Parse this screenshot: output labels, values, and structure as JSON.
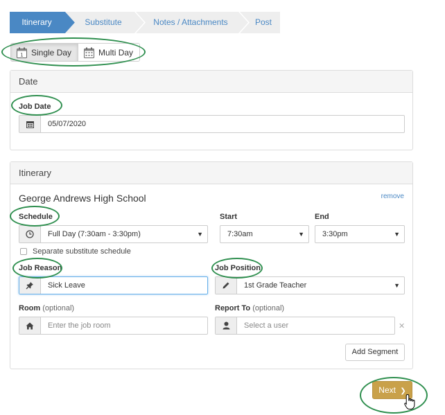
{
  "wizard": {
    "steps": [
      "Itinerary",
      "Substitute",
      "Notes / Attachments",
      "Post"
    ],
    "active_index": 0
  },
  "day_toggle": {
    "single_label": "Single Day",
    "multi_label": "Multi Day",
    "selected": "single",
    "single_icon_text": "1"
  },
  "date_panel": {
    "title": "Date",
    "job_date_label": "Job Date",
    "job_date_value": "05/07/2020"
  },
  "itinerary_panel": {
    "title": "Itinerary",
    "school": "George Andrews High School",
    "remove_label": "remove",
    "schedule_label": "Schedule",
    "schedule_value": "Full Day (7:30am - 3:30pm)",
    "start_label": "Start",
    "start_value": "7:30am",
    "end_label": "End",
    "end_value": "3:30pm",
    "separate_schedule_label": "Separate substitute schedule",
    "separate_schedule_checked": false,
    "job_reason_label": "Job Reason",
    "job_reason_value": "Sick Leave",
    "job_position_label": "Job Position",
    "job_position_value": "1st Grade Teacher",
    "room_label": "Room",
    "room_optional": "(optional)",
    "room_placeholder": "Enter the job room",
    "report_to_label": "Report To",
    "report_to_optional": "(optional)",
    "report_to_placeholder": "Select a user",
    "clear_symbol": "✕",
    "add_segment_label": "Add Segment"
  },
  "footer": {
    "next_label": "Next",
    "next_chevron": "❯"
  },
  "colors": {
    "active_step": "#4a88c4",
    "inactive_step": "#eeeeee",
    "accent_button": "#c9a14a",
    "annotation": "#2f8f4f",
    "link": "#4a88c4"
  },
  "icons": {
    "calendar": "calendar-icon",
    "clock": "clock-icon",
    "pin": "pushpin-icon",
    "pencil": "pencil-icon",
    "home": "home-icon",
    "user": "user-icon",
    "chevron": "chevron-right-icon",
    "cursor": "hand-cursor-icon"
  }
}
